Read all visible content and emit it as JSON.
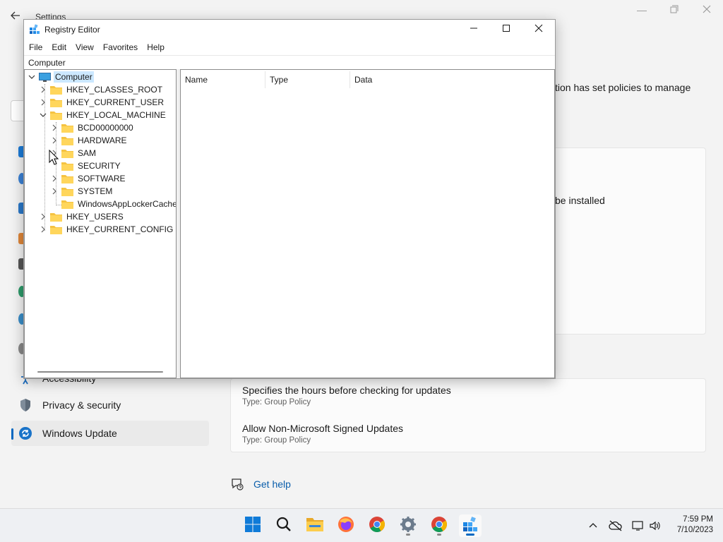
{
  "settings": {
    "title": "Settings",
    "policy_text": "tion has set policies to manage",
    "install_text": "be installed",
    "sidebar": [
      {
        "label": "Accessibility",
        "icon": "accessibility-icon"
      },
      {
        "label": "Privacy & security",
        "icon": "shield-icon"
      },
      {
        "label": "Windows Update",
        "icon": "windows-update-icon"
      }
    ],
    "policies": [
      {
        "title": "Specifies the hours before checking for updates",
        "type": "Type: Group Policy"
      },
      {
        "title": "Allow Non-Microsoft Signed Updates",
        "type": "Type: Group Policy"
      }
    ],
    "get_help": "Get help"
  },
  "regedit": {
    "title": "Registry Editor",
    "menu": [
      "File",
      "Edit",
      "View",
      "Favorites",
      "Help"
    ],
    "address": "Computer",
    "tree": [
      {
        "label": "Computer",
        "expanded": true
      },
      {
        "label": "HKEY_CLASSES_ROOT"
      },
      {
        "label": "HKEY_CURRENT_USER"
      },
      {
        "label": "HKEY_LOCAL_MACHINE",
        "expanded": true
      },
      {
        "label": "BCD00000000"
      },
      {
        "label": "HARDWARE"
      },
      {
        "label": "SAM"
      },
      {
        "label": "SECURITY"
      },
      {
        "label": "SOFTWARE"
      },
      {
        "label": "SYSTEM"
      },
      {
        "label": "WindowsAppLockerCache"
      },
      {
        "label": "HKEY_USERS"
      },
      {
        "label": "HKEY_CURRENT_CONFIG"
      }
    ],
    "columns": [
      "Name",
      "Type",
      "Data"
    ]
  },
  "taskbar": {
    "apps": [
      "start-icon",
      "search-icon",
      "file-explorer-icon",
      "firefox-icon",
      "chrome-icon",
      "settings-icon",
      "chrome-icon",
      "registry-editor-icon"
    ],
    "time": "7:59 PM",
    "date": "7/10/2023"
  },
  "colors": {
    "accent": "#0067c0",
    "folder": "#f5c342",
    "selection": "#cce8ff"
  }
}
